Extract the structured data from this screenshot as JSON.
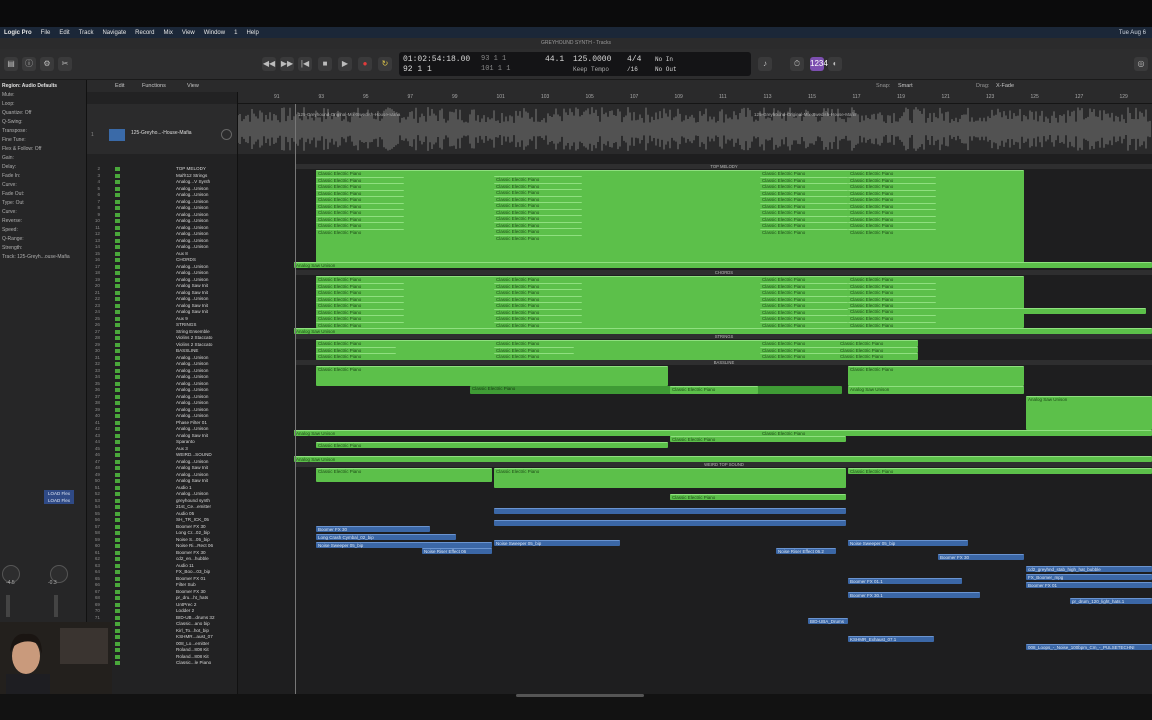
{
  "menubar": {
    "app": "Logic Pro",
    "items": [
      "File",
      "Edit",
      "Track",
      "Navigate",
      "Record",
      "Mix",
      "View",
      "Window",
      "1",
      "Help"
    ],
    "clock": "Tue Aug 6"
  },
  "window_title": "GREYHOUND SYNTH - Tracks",
  "lcd": {
    "time": "01:02:54:18.00",
    "bars": "93  1  1",
    "bars2": "92  1  1",
    "subbars": "101  1  1",
    "sample_rate": "44.1",
    "tempo": "125.0000",
    "tempo_label": "Keep Tempo",
    "sig": "4/4",
    "div": "/16",
    "in": "No In",
    "out": "No Out"
  },
  "lcd_counter_top": "93  1  1   1",
  "inspector": {
    "region_label": "Region: Audio Defaults",
    "rows": [
      "Mute:",
      "Loop:",
      "Quantize: Off",
      "Q-Swing:",
      "Transpose:",
      "Fine Tune:",
      "Flex & Follow: Off",
      "Gain:",
      "Delay:",
      "Fade In:",
      "Curve:",
      "Fade Out:",
      "Type: Out",
      "Curve:",
      "Reverse:",
      "Speed:",
      "Q-Range:",
      "Strength:",
      "Track: 125-Greyh...ouse-Mafia"
    ],
    "channel1": "LOAD Flex",
    "channel2": "LOAD Flex",
    "meter_a": "-4.5",
    "meter_b": "-0.3"
  },
  "editbar": {
    "edit": "Edit",
    "functions": "Functions",
    "view": "View",
    "snap_label": "Snap:",
    "snap_value": "Smart",
    "drag_label": "Drag:",
    "drag_value": "X-Fade"
  },
  "ruler": {
    "bars": [
      "91",
      "93",
      "95",
      "97",
      "99",
      "101",
      "103",
      "105",
      "107",
      "109",
      "111",
      "113",
      "115",
      "117",
      "119",
      "121",
      "123",
      "125",
      "127",
      "129"
    ]
  },
  "audio_track": {
    "num": "1",
    "name": "125-Greyho...-House-Mafia",
    "region_label": "125-Greyhound-Original-Mix-Swedish-House-Mafia"
  },
  "tracks": [
    {
      "num": "2",
      "name": "TOP MELODY"
    },
    {
      "num": "3",
      "name": "Mal'lt12 Strings"
    },
    {
      "num": "4",
      "name": "Analog...V Synth"
    },
    {
      "num": "5",
      "name": "Analog...Unison"
    },
    {
      "num": "6",
      "name": "Analog...Unison"
    },
    {
      "num": "7",
      "name": "Analog...Unison"
    },
    {
      "num": "8",
      "name": "Analog...Unison"
    },
    {
      "num": "9",
      "name": "Analog...Unison"
    },
    {
      "num": "10",
      "name": "Analog...Unison"
    },
    {
      "num": "11",
      "name": "Analog...Unison"
    },
    {
      "num": "12",
      "name": "Analog...Unison"
    },
    {
      "num": "13",
      "name": "Analog...Unison"
    },
    {
      "num": "14",
      "name": "Analog...Unison"
    },
    {
      "num": "15",
      "name": "Aux 8"
    },
    {
      "num": "16",
      "name": "CHORDS"
    },
    {
      "num": "17",
      "name": "Analog...Unison"
    },
    {
      "num": "18",
      "name": "Analog...Unison"
    },
    {
      "num": "19",
      "name": "Analog...Unison"
    },
    {
      "num": "20",
      "name": "Analog Saw Init"
    },
    {
      "num": "21",
      "name": "Analog Saw Init"
    },
    {
      "num": "22",
      "name": "Analog...Unison"
    },
    {
      "num": "23",
      "name": "Analog Saw Init"
    },
    {
      "num": "24",
      "name": "Analog Saw Init"
    },
    {
      "num": "25",
      "name": "Aux 9"
    },
    {
      "num": "26",
      "name": "STRINGS"
    },
    {
      "num": "27",
      "name": "String Ensemble"
    },
    {
      "num": "28",
      "name": "Violins 2 Staccato"
    },
    {
      "num": "29",
      "name": "Violins 2 Staccato"
    },
    {
      "num": "30",
      "name": "BASSLINE"
    },
    {
      "num": "31",
      "name": "Analog...Unison"
    },
    {
      "num": "32",
      "name": "Analog...Unison"
    },
    {
      "num": "33",
      "name": "Analog...Unison"
    },
    {
      "num": "34",
      "name": "Analog...Unison"
    },
    {
      "num": "35",
      "name": "Analog...Unison"
    },
    {
      "num": "36",
      "name": "Analog...Unison"
    },
    {
      "num": "37",
      "name": "Analog...Unison"
    },
    {
      "num": "38",
      "name": "Analog...Unison"
    },
    {
      "num": "39",
      "name": "Analog...Unison"
    },
    {
      "num": "40",
      "name": "Analog...Unison"
    },
    {
      "num": "41",
      "name": "Phase Filter 01"
    },
    {
      "num": "42",
      "name": "Analog...Unison"
    },
    {
      "num": "43",
      "name": "Analog Saw Init"
    },
    {
      "num": "44",
      "name": "Sparanto"
    },
    {
      "num": "45",
      "name": "Aux 3"
    },
    {
      "num": "46",
      "name": "WEIRD...SOUND"
    },
    {
      "num": "47",
      "name": "Analog...Unison"
    },
    {
      "num": "48",
      "name": "Analog Saw Init"
    },
    {
      "num": "49",
      "name": "Analog...Unison"
    },
    {
      "num": "50",
      "name": "Analog Saw Init"
    },
    {
      "num": "51",
      "name": "Audio 1"
    },
    {
      "num": "52",
      "name": "Analog...Unison"
    },
    {
      "num": "53",
      "name": "greyhound synth"
    },
    {
      "num": "54",
      "name": "21st_Ce...emitter"
    },
    {
      "num": "55",
      "name": "Audio 05"
    },
    {
      "num": "56",
      "name": "SH_TR_ICK_05"
    },
    {
      "num": "57",
      "name": "Boomer FX 30"
    },
    {
      "num": "58",
      "name": "Long Cr...02_bip"
    },
    {
      "num": "59",
      "name": "Noise S...05_bip"
    },
    {
      "num": "60",
      "name": "Noise Ri...Rect 06"
    },
    {
      "num": "61",
      "name": "Boomer FX 30"
    },
    {
      "num": "62",
      "name": "cd2_en...hubble"
    },
    {
      "num": "63",
      "name": "Audio 11"
    },
    {
      "num": "64",
      "name": "FX_Boo...03_bip"
    },
    {
      "num": "65",
      "name": "Boomer FX 01"
    },
    {
      "num": "66",
      "name": "Filter Sub"
    },
    {
      "num": "67",
      "name": "Boomer FX 30"
    },
    {
      "num": "68",
      "name": "pr_dru...ht_hats"
    },
    {
      "num": "69",
      "name": "UntPrec 2"
    },
    {
      "num": "70",
      "name": "Lodder 2"
    },
    {
      "num": "71",
      "name": "BID-UB...drums 32"
    },
    {
      "num": "72",
      "name": "Classic...ano bip"
    },
    {
      "num": "73",
      "name": "Kirl_To...hot_bip"
    },
    {
      "num": "74",
      "name": "KSHMR...aust_07"
    },
    {
      "num": "75",
      "name": "008_Lo...emitter"
    },
    {
      "num": "76",
      "name": "Roland...808 Kit"
    },
    {
      "num": "77",
      "name": "Roland...808 Kit"
    },
    {
      "num": "78",
      "name": "Classic...le Piano"
    }
  ],
  "folders": [
    {
      "label": "TOP MELODY"
    },
    {
      "label": "CHORDS"
    },
    {
      "label": "STRINGS"
    },
    {
      "label": "BASSLINE"
    },
    {
      "label": "WEIRD TOP SOUND"
    }
  ],
  "region_names": {
    "piano": "Classic Electric Piano",
    "saw": "Analog Saw Unison",
    "boomer": "Boomer FX 30",
    "longcrash": "Long Crash Cymbal_02_bip",
    "noisesweep": "Noise Sweeper 05_bip",
    "noiseriser": "Noise Riser Effect 06",
    "noiseriser2": "Noise Riser Effect 06.2",
    "boomerfx01": "Boomer FX 01.1",
    "boomer30b": "Boomer FX 30.1",
    "drums": "BID-UBA_Drums",
    "kshmr": "KSHMR_Exhaust_07.1",
    "loops": "008_Loops_-_Noise_100bpm_Cm_-_PULSETECHNI",
    "cd2": "cd2_greyhnd_stab_high_hat_bubble",
    "fxboomer": "FX_Boomer_mpg",
    "boomer01b": "Boomer FX 01",
    "prdrum": "pr_drum_120_light_hats.1"
  }
}
